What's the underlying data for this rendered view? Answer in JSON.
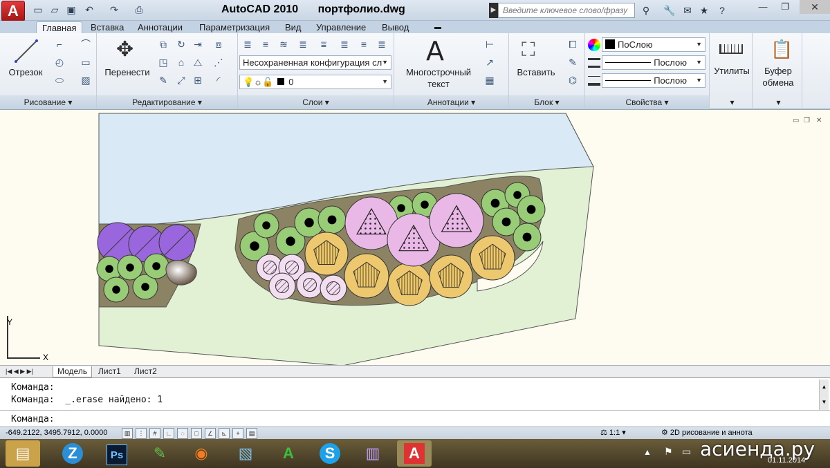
{
  "app": {
    "title": "AutoCAD 2010",
    "document": "портфолио.dwg",
    "logo_letter": "A"
  },
  "quick_access": [
    "new-icon",
    "open-icon",
    "save-icon",
    "undo-icon",
    "redo-icon",
    "plot-icon"
  ],
  "search": {
    "placeholder": "Введите ключевое слово/фразу"
  },
  "ribbon_tabs": [
    "Главная",
    "Вставка",
    "Аннотации",
    "Параметризация",
    "Вид",
    "Управление",
    "Вывод"
  ],
  "panels": {
    "draw": {
      "label": "Рисование",
      "big": "Отрезок"
    },
    "modify": {
      "label": "Редактирование",
      "big": "Перенести"
    },
    "layers": {
      "label": "Слои",
      "config": "Несохраненная конфигурация сл",
      "layer": "0"
    },
    "annotation": {
      "label": "Аннотации",
      "big_line1": "Многострочный",
      "big_line2": "текст"
    },
    "block": {
      "label": "Блок",
      "big": "Вставить"
    },
    "properties": {
      "label": "Свойства",
      "color": "ПоСлою",
      "linetype": "Послою",
      "lineweight": "Послою"
    },
    "utilities": {
      "label": "Утилиты"
    },
    "clipboard": {
      "label_line1": "Буфер",
      "label_line2": "обмена"
    }
  },
  "layout_tabs": [
    "Модель",
    "Лист1",
    "Лист2"
  ],
  "ucs": {
    "x": "X",
    "y": "Y"
  },
  "command": {
    "line1": "Команда:",
    "line2": "Команда:  _.erase найдено: 1",
    "prompt": "Команда:"
  },
  "status": {
    "coords": "-649.2122, 3495.7912, 0.0000",
    "scale": "1:1",
    "workspace": "2D рисование и аннота"
  },
  "taskbar": {
    "date": "01.11.2014"
  },
  "watermark": "асиенда.ру",
  "colors": {
    "ribbon": "#e9eef4",
    "canvas": "#fefcf0",
    "water": "#d9e9f6",
    "lawn": "#e0f0d0",
    "bed": "#8c8364",
    "shrub": "#99cc77",
    "purple": "#9966dd",
    "pink": "#e9b8e6",
    "gold": "#eec86e",
    "light_pink": "#f3ddf0"
  }
}
